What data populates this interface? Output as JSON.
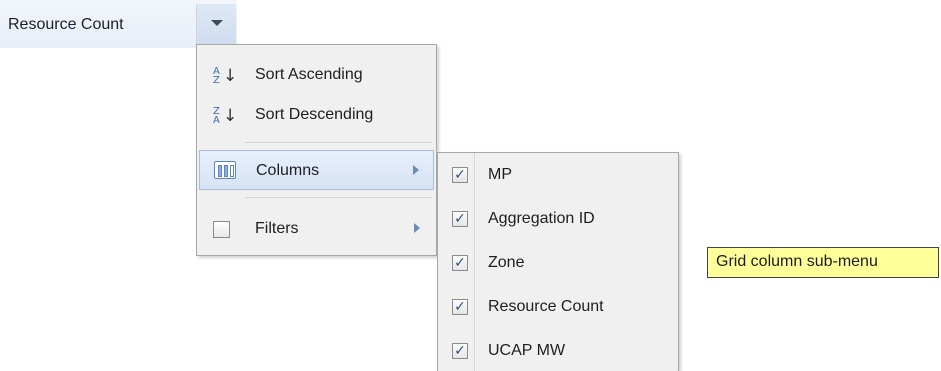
{
  "column_header": {
    "label": "Resource Count"
  },
  "menu": {
    "items": [
      {
        "label": "Sort Ascending",
        "icon": "sort-ascending-icon"
      },
      {
        "label": "Sort Descending",
        "icon": "sort-descending-icon"
      },
      {
        "label": "Columns",
        "icon": "columns-icon",
        "has_submenu": true,
        "active": true
      },
      {
        "label": "Filters",
        "icon": "checkbox-icon",
        "has_submenu": true
      }
    ]
  },
  "columns_submenu": {
    "items": [
      {
        "label": "MP",
        "checked": true
      },
      {
        "label": "Aggregation ID",
        "checked": true
      },
      {
        "label": "Zone",
        "checked": true
      },
      {
        "label": "Resource Count",
        "checked": true
      },
      {
        "label": "UCAP MW",
        "checked": true
      }
    ]
  },
  "callout": {
    "text": "Grid column sub-menu"
  },
  "colors": {
    "accent": "#3a6fb0",
    "callout_bg": "#ffff99",
    "menu_bg": "#f0f0f0"
  }
}
